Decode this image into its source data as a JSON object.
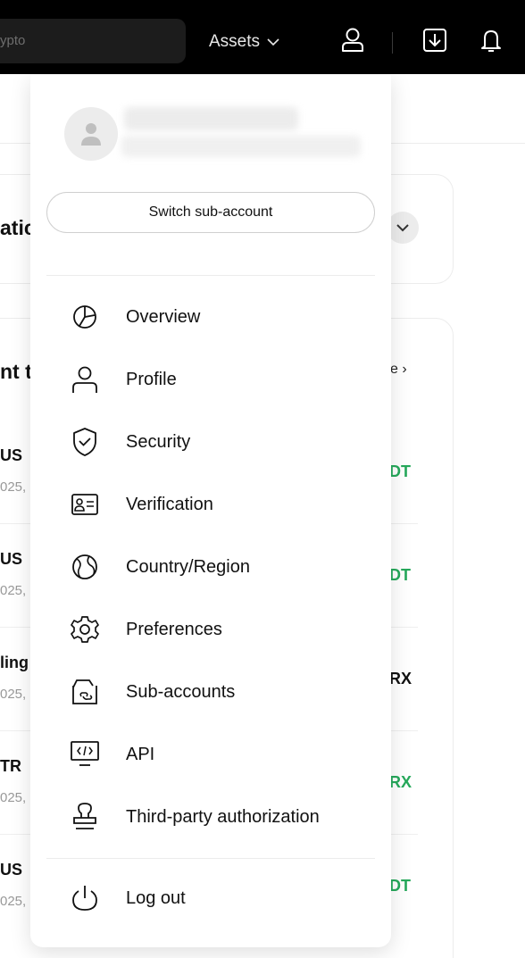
{
  "header": {
    "search_placeholder": "ypto",
    "assets_label": "Assets"
  },
  "background": {
    "card1_title": "atic",
    "card2_title": "nt t",
    "more_link": "e ›",
    "transactions": [
      {
        "name": "US",
        "date": "025,",
        "value": "DT",
        "color": "#26a95b"
      },
      {
        "name": "US",
        "date": "025,",
        "value": "DT",
        "color": "#26a95b"
      },
      {
        "name": "ling",
        "date": "025,",
        "value": "RX",
        "color": "#111111"
      },
      {
        "name": "TR",
        "date": "025,",
        "value": "RX",
        "color": "#26a95b"
      },
      {
        "name": "US",
        "date": "025,",
        "value": "DT",
        "color": "#26a95b"
      }
    ]
  },
  "menu": {
    "switch_label": "Switch sub-account",
    "items": [
      {
        "label": "Overview",
        "icon": "pie-chart-icon"
      },
      {
        "label": "Profile",
        "icon": "person-icon"
      },
      {
        "label": "Security",
        "icon": "shield-check-icon"
      },
      {
        "label": "Verification",
        "icon": "id-card-icon"
      },
      {
        "label": "Country/Region",
        "icon": "globe-icon"
      },
      {
        "label": "Preferences",
        "icon": "gear-icon"
      },
      {
        "label": "Sub-accounts",
        "icon": "wallet-link-icon"
      },
      {
        "label": "API",
        "icon": "code-monitor-icon"
      },
      {
        "label": "Third-party authorization",
        "icon": "stamp-icon"
      }
    ],
    "logout_label": "Log out"
  },
  "colors": {
    "topbar": "#000000",
    "positive": "#26a95b",
    "border": "#ececec"
  }
}
